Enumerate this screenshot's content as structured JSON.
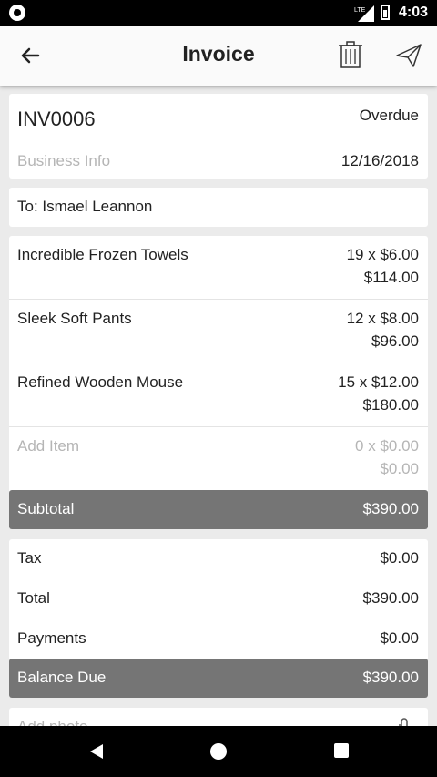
{
  "status_bar": {
    "time": "4:03",
    "network": "LTE"
  },
  "header": {
    "title": "Invoice"
  },
  "invoice": {
    "number": "INV0006",
    "status": "Overdue",
    "business_info_placeholder": "Business Info",
    "date": "12/16/2018",
    "to": "To: Ismael Leannon"
  },
  "items": [
    {
      "name": "Incredible Frozen Towels",
      "qty_price": "19 x $6.00",
      "amount": "$114.00"
    },
    {
      "name": "Sleek Soft Pants",
      "qty_price": "12 x $8.00",
      "amount": "$96.00"
    },
    {
      "name": "Refined Wooden Mouse",
      "qty_price": "15 x $12.00",
      "amount": "$180.00"
    }
  ],
  "add_item": {
    "name": "Add Item",
    "qty_price": "0 x $0.00",
    "amount": "$0.00"
  },
  "subtotal": {
    "label": "Subtotal",
    "value": "$390.00"
  },
  "totals": {
    "tax_label": "Tax",
    "tax_value": "$0.00",
    "total_label": "Total",
    "total_value": "$390.00",
    "payments_label": "Payments",
    "payments_value": "$0.00"
  },
  "balance_due": {
    "label": "Balance Due",
    "value": "$390.00"
  },
  "add_photo": {
    "label": "Add photo"
  },
  "colors": {
    "background": "#ebebeb",
    "summary_bar": "#757575",
    "placeholder_text": "#b5b5b5"
  }
}
